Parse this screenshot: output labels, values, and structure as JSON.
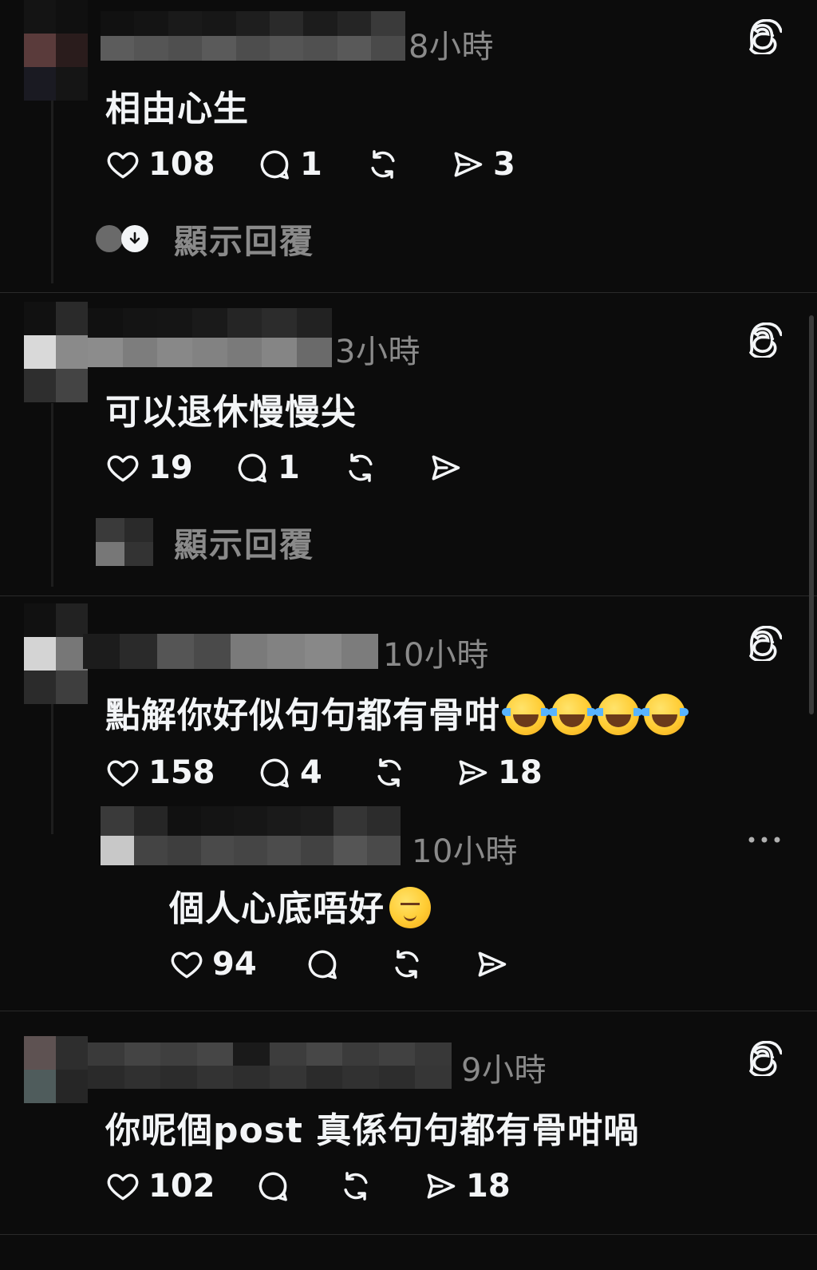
{
  "icons": {
    "like": "heart-icon",
    "reply": "comment-icon",
    "repost": "repost-icon",
    "share": "send-icon",
    "brand": "threads-icon",
    "more": "more-icon"
  },
  "colors": {
    "background": "#0c0c0c",
    "text": "#f3f5f7",
    "secondary": "#8a8a8a",
    "divider": "#2a2a2a"
  },
  "show_replies_label": "顯示回覆",
  "posts": [
    {
      "time": "8小時",
      "text": "相由心生",
      "likes": "108",
      "replies": "1",
      "shares": "3",
      "show_replies": "顯示回覆"
    },
    {
      "time": "3小時",
      "text": "可以退休慢慢尖",
      "likes": "19",
      "replies": "1",
      "shares": "",
      "show_replies": "顯示回覆"
    },
    {
      "time": "10小時",
      "text": "點解你好似句句都有骨咁",
      "emojis": [
        "😂",
        "😂",
        "😂",
        "😂"
      ],
      "likes": "158",
      "replies": "4",
      "shares": "18",
      "reply": {
        "time": "10小時",
        "text": "個人心底唔好",
        "emojis": [
          "😌"
        ],
        "likes": "94",
        "replies": "",
        "shares": ""
      }
    },
    {
      "time": "9小時",
      "text": "你呢個post 真係句句都有骨咁喎",
      "likes": "102",
      "replies": "",
      "shares": "18"
    }
  ]
}
